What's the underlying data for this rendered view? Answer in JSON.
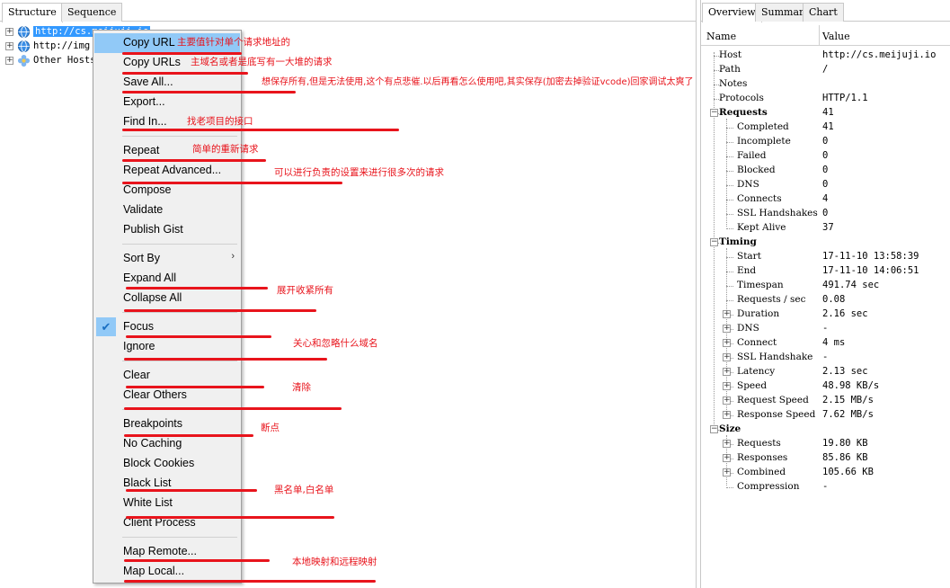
{
  "left_panel": {
    "tabs": [
      "Structure",
      "Sequence"
    ],
    "tree": [
      {
        "label": "http://cs.meijuji.io",
        "expander": "+",
        "selected": true
      },
      {
        "label": "http://img",
        "expander": "+",
        "selected": false
      },
      {
        "label": "Other Hosts",
        "expander": "+",
        "selected": false
      }
    ]
  },
  "context_menu": {
    "items": [
      {
        "label": "Copy URL",
        "highlighted": true
      },
      {
        "label": "Copy URLs"
      },
      {
        "label": "Save All..."
      },
      {
        "label": "Export..."
      },
      {
        "label": "Find In..."
      },
      {
        "label": "Repeat"
      },
      {
        "label": "Repeat Advanced..."
      },
      {
        "label": "Compose"
      },
      {
        "label": "Validate"
      },
      {
        "label": "Publish Gist"
      },
      {
        "label": "Sort By",
        "submenu": true
      },
      {
        "label": "Expand All"
      },
      {
        "label": "Collapse All"
      },
      {
        "label": "Focus",
        "checked": true
      },
      {
        "label": "Ignore"
      },
      {
        "label": "Clear"
      },
      {
        "label": "Clear Others"
      },
      {
        "label": "Breakpoints"
      },
      {
        "label": "No Caching"
      },
      {
        "label": "Block Cookies"
      },
      {
        "label": "Black List"
      },
      {
        "label": "White List"
      },
      {
        "label": "Client Process"
      },
      {
        "label": "Map Remote..."
      },
      {
        "label": "Map Local..."
      }
    ],
    "submenu_glyph": "›",
    "check_glyph": "✔"
  },
  "annotations": [
    "主要值针对单个请求地址的",
    "主域名或者是底写有一大堆的请求",
    "想保存所有,但是无法使用,这个有点悲催.以后再看怎么使用吧,其实保存(加密去掉验证vcode)回家调试太爽了",
    "找老项目的接口",
    "简单的重新请求",
    "可以进行负责的设置来进行很多次的请求",
    "展开收紧所有",
    "关心和忽略什么域名",
    "清除",
    "断点",
    "黑名单,白名单",
    "本地映射和远程映射"
  ],
  "right_panel": {
    "tabs": [
      "Overview",
      "Summary",
      "Chart"
    ],
    "columns": {
      "name": "Name",
      "value": "Value"
    },
    "rows": [
      {
        "name": "Host",
        "value": "http://cs.meijuji.io",
        "level": 0
      },
      {
        "name": "Path",
        "value": "/",
        "level": 0
      },
      {
        "name": "Notes",
        "value": "",
        "level": 0
      },
      {
        "name": "Protocols",
        "value": "HTTP/1.1",
        "level": 0
      },
      {
        "name": "Requests",
        "value": "41",
        "level": 0,
        "bold": true,
        "expander": "−"
      },
      {
        "name": "Completed",
        "value": "41",
        "level": 1
      },
      {
        "name": "Incomplete",
        "value": "0",
        "level": 1
      },
      {
        "name": "Failed",
        "value": "0",
        "level": 1
      },
      {
        "name": "Blocked",
        "value": "0",
        "level": 1
      },
      {
        "name": "DNS",
        "value": "0",
        "level": 1
      },
      {
        "name": "Connects",
        "value": "4",
        "level": 1
      },
      {
        "name": "SSL Handshakes",
        "value": "0",
        "level": 1
      },
      {
        "name": "Kept Alive",
        "value": "37",
        "level": 1
      },
      {
        "name": "Timing",
        "value": "",
        "level": 0,
        "bold": true,
        "expander": "−"
      },
      {
        "name": "Start",
        "value": "17-11-10 13:58:39",
        "level": 1
      },
      {
        "name": "End",
        "value": "17-11-10 14:06:51",
        "level": 1
      },
      {
        "name": "Timespan",
        "value": "491.74 sec",
        "level": 1
      },
      {
        "name": "Requests / sec",
        "value": "0.08",
        "level": 1
      },
      {
        "name": "Duration",
        "value": "2.16 sec",
        "level": 1,
        "expander": "+"
      },
      {
        "name": "DNS",
        "value": "-",
        "level": 1,
        "expander": "+"
      },
      {
        "name": "Connect",
        "value": "4 ms",
        "level": 1,
        "expander": "+"
      },
      {
        "name": "SSL Handshake",
        "value": "-",
        "level": 1,
        "expander": "+"
      },
      {
        "name": "Latency",
        "value": "2.13 sec",
        "level": 1,
        "expander": "+"
      },
      {
        "name": "Speed",
        "value": "48.98 KB/s",
        "level": 1,
        "expander": "+"
      },
      {
        "name": "Request Speed",
        "value": "2.15 MB/s",
        "level": 1,
        "expander": "+"
      },
      {
        "name": "Response Speed",
        "value": "7.62 MB/s",
        "level": 1,
        "expander": "+"
      },
      {
        "name": "Size",
        "value": "",
        "level": 0,
        "bold": true,
        "expander": "−"
      },
      {
        "name": "Requests",
        "value": "19.80 KB",
        "level": 1,
        "expander": "+"
      },
      {
        "name": "Responses",
        "value": "85.86 KB",
        "level": 1,
        "expander": "+"
      },
      {
        "name": "Combined",
        "value": "105.66 KB",
        "level": 1,
        "expander": "+"
      },
      {
        "name": "Compression",
        "value": "-",
        "level": 1
      }
    ]
  },
  "colors": {
    "accent": "#3399ff",
    "highlight": "#91c9f7",
    "annotation": "#e8141c"
  }
}
